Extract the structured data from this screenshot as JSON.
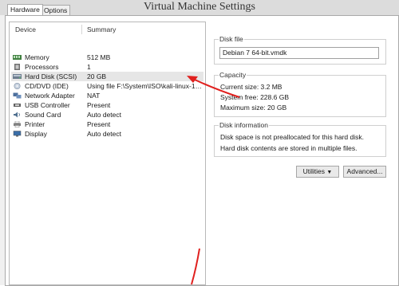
{
  "window": {
    "title": "Virtual Machine Settings"
  },
  "tabs": [
    {
      "label": "Hardware"
    },
    {
      "label": "Options"
    }
  ],
  "device_list": {
    "columns": {
      "device": "Device",
      "summary": "Summary"
    },
    "rows": [
      {
        "device": "Memory",
        "summary": "512 MB",
        "icon": "memory-icon"
      },
      {
        "device": "Processors",
        "summary": "1",
        "icon": "processor-icon"
      },
      {
        "device": "Hard Disk (SCSI)",
        "summary": "20 GB",
        "icon": "hard-disk-icon"
      },
      {
        "device": "CD/DVD (IDE)",
        "summary": "Using file F:\\System\\ISO\\kali-linux-1.1...",
        "icon": "cd-dvd-icon"
      },
      {
        "device": "Network Adapter",
        "summary": "NAT",
        "icon": "network-adapter-icon"
      },
      {
        "device": "USB Controller",
        "summary": "Present",
        "icon": "usb-controller-icon"
      },
      {
        "device": "Sound Card",
        "summary": "Auto detect",
        "icon": "sound-card-icon"
      },
      {
        "device": "Printer",
        "summary": "Present",
        "icon": "printer-icon"
      },
      {
        "device": "Display",
        "summary": "Auto detect",
        "icon": "display-icon"
      }
    ]
  },
  "disk_file": {
    "label": "Disk file",
    "value": "Debian 7 64-bit.vmdk"
  },
  "capacity": {
    "label": "Capacity",
    "current_size": "Current size: 3.2 MB",
    "system_free": "System free: 228.6 GB",
    "maximum_size": "Maximum size: 20 GB"
  },
  "disk_information": {
    "label": "Disk information",
    "line1": "Disk space is not preallocated for this hard disk.",
    "line2": "Hard disk contents are stored in multiple files."
  },
  "buttons": {
    "utilities": "Utilities",
    "advanced": "Advanced..."
  },
  "colors": {
    "annotation_arrow": "#e0201e"
  }
}
